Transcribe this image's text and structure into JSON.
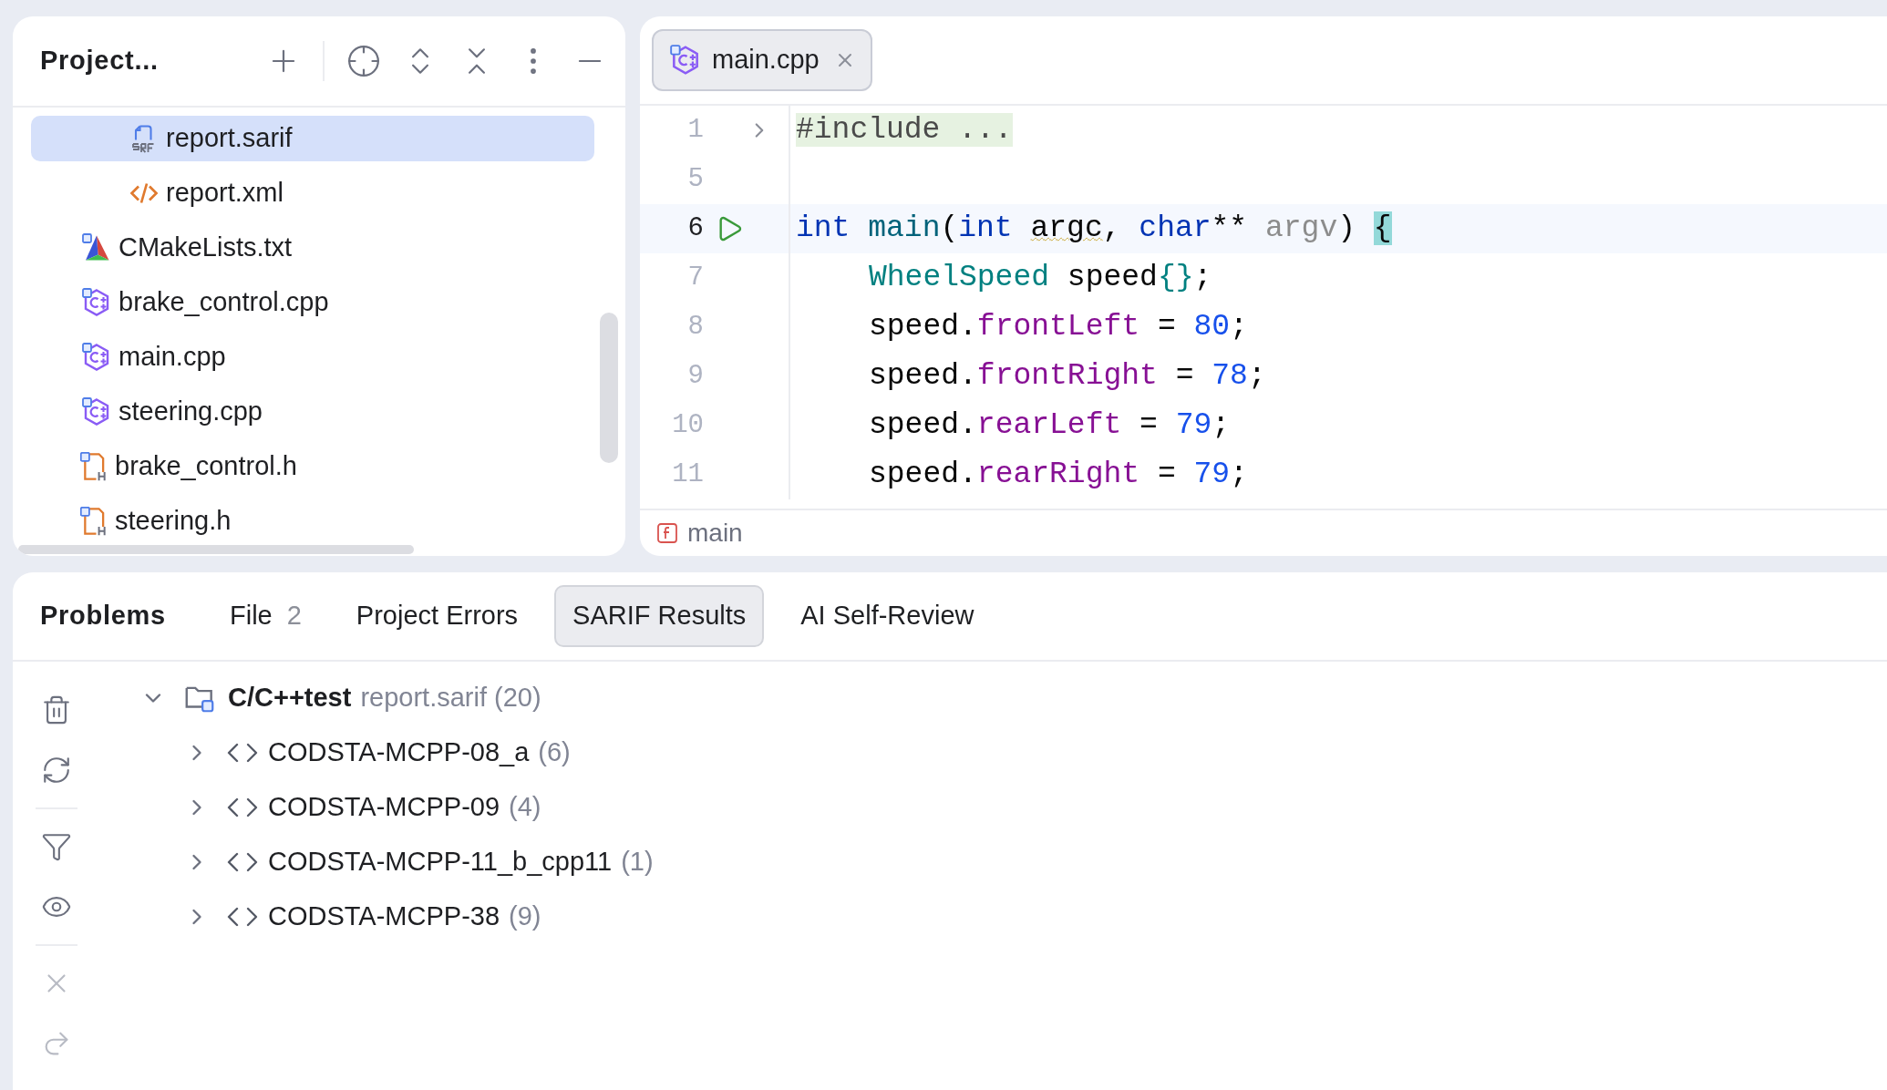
{
  "project_panel": {
    "title": "Project...",
    "tree": [
      {
        "children": [
          {
            "name": "report.sarif",
            "kind": "sarif",
            "selected": true
          },
          {
            "name": "report.xml",
            "kind": "xml",
            "selected": false
          }
        ]
      },
      {
        "name": "CMakeLists.txt",
        "kind": "cmake",
        "selected": false
      },
      {
        "name": "brake_control.cpp",
        "kind": "cpp",
        "selected": false
      },
      {
        "name": "main.cpp",
        "kind": "cpp",
        "selected": false
      },
      {
        "name": "steering.cpp",
        "kind": "cpp",
        "selected": false
      },
      {
        "name": "brake_control.h",
        "kind": "header",
        "selected": false
      },
      {
        "name": "steering.h",
        "kind": "header",
        "selected": false
      }
    ]
  },
  "editor": {
    "tabs": [
      {
        "label": "main.cpp",
        "selected": true
      }
    ],
    "lines": [
      {
        "number": "1",
        "kind": "fold",
        "current": false,
        "indented": false,
        "tokens": [
          {
            "text": "#include ...",
            "kind": "folded"
          }
        ]
      },
      {
        "number": "5",
        "current": false
      },
      {
        "number": "6",
        "kind": "run",
        "current": true,
        "indented": false,
        "tokens": [
          {
            "text": "int",
            "kind": "keyword"
          },
          {
            "text": " main",
            "kind": "function"
          },
          {
            "text": "(",
            "kind": "plain"
          },
          {
            "text": "int",
            "kind": "keyword"
          },
          {
            "text": " argc",
            "kind": "warning"
          },
          {
            "text": ", ",
            "kind": "plain"
          },
          {
            "text": "char",
            "kind": "keyword"
          },
          {
            "text": "** ",
            "kind": "plain"
          },
          {
            "text": "argv",
            "kind": "unused"
          },
          {
            "text": ") ",
            "kind": "plain"
          },
          {
            "text": "{",
            "kind": "matched"
          }
        ]
      },
      {
        "number": "7",
        "current": false,
        "indented": true,
        "tokens": [
          {
            "text": "WheelSpeed",
            "kind": "type"
          },
          {
            "text": " speed",
            "kind": "plain"
          },
          {
            "text": "{}",
            "kind": "type"
          },
          {
            "text": ";",
            "kind": "plain"
          }
        ]
      },
      {
        "number": "8",
        "current": false,
        "indented": true,
        "tokens": [
          {
            "text": "speed.",
            "kind": "plain"
          },
          {
            "text": "frontLeft",
            "kind": "field"
          },
          {
            "text": " = ",
            "kind": "plain"
          },
          {
            "text": "80",
            "kind": "number"
          },
          {
            "text": ";",
            "kind": "plain"
          }
        ]
      },
      {
        "number": "9",
        "current": false,
        "indented": true,
        "tokens": [
          {
            "text": "speed.",
            "kind": "plain"
          },
          {
            "text": "frontRight",
            "kind": "field"
          },
          {
            "text": " = ",
            "kind": "plain"
          },
          {
            "text": "78",
            "kind": "number"
          },
          {
            "text": ";",
            "kind": "plain"
          }
        ]
      },
      {
        "number": "10",
        "current": false,
        "indented": true,
        "tokens": [
          {
            "text": "speed.",
            "kind": "plain"
          },
          {
            "text": "rearLeft",
            "kind": "field"
          },
          {
            "text": " = ",
            "kind": "plain"
          },
          {
            "text": "79",
            "kind": "number"
          },
          {
            "text": ";",
            "kind": "plain"
          }
        ]
      },
      {
        "number": "11",
        "current": false,
        "indented": true,
        "tokens": [
          {
            "text": "speed.",
            "kind": "plain"
          },
          {
            "text": "rearRight",
            "kind": "field"
          },
          {
            "text": " = ",
            "kind": "plain"
          },
          {
            "text": "79",
            "kind": "number"
          },
          {
            "text": ";",
            "kind": "plain"
          }
        ]
      }
    ],
    "breadcrumb": "main"
  },
  "problems_panel": {
    "title": "Problems",
    "tabs": [
      {
        "label": "File",
        "count": "2",
        "selected": false
      },
      {
        "label": "Project Errors",
        "selected": false
      },
      {
        "label": "SARIF Results",
        "selected": true
      },
      {
        "label": "AI Self-Review",
        "selected": false
      }
    ],
    "tree": [
      {
        "tool": "C/C++test",
        "file": "report.sarif (20)",
        "expanded": true,
        "children": [
          {
            "rule": "CODSTA-MCPP-08_a",
            "count": "(6)",
            "expanded": false
          },
          {
            "rule": "CODSTA-MCPP-09",
            "count": "(4)",
            "expanded": false
          },
          {
            "rule": "CODSTA-MCPP-11_b_cpp11",
            "count": "(1)",
            "expanded": false
          },
          {
            "rule": "CODSTA-MCPP-38",
            "count": "(9)",
            "expanded": false
          }
        ]
      }
    ]
  }
}
